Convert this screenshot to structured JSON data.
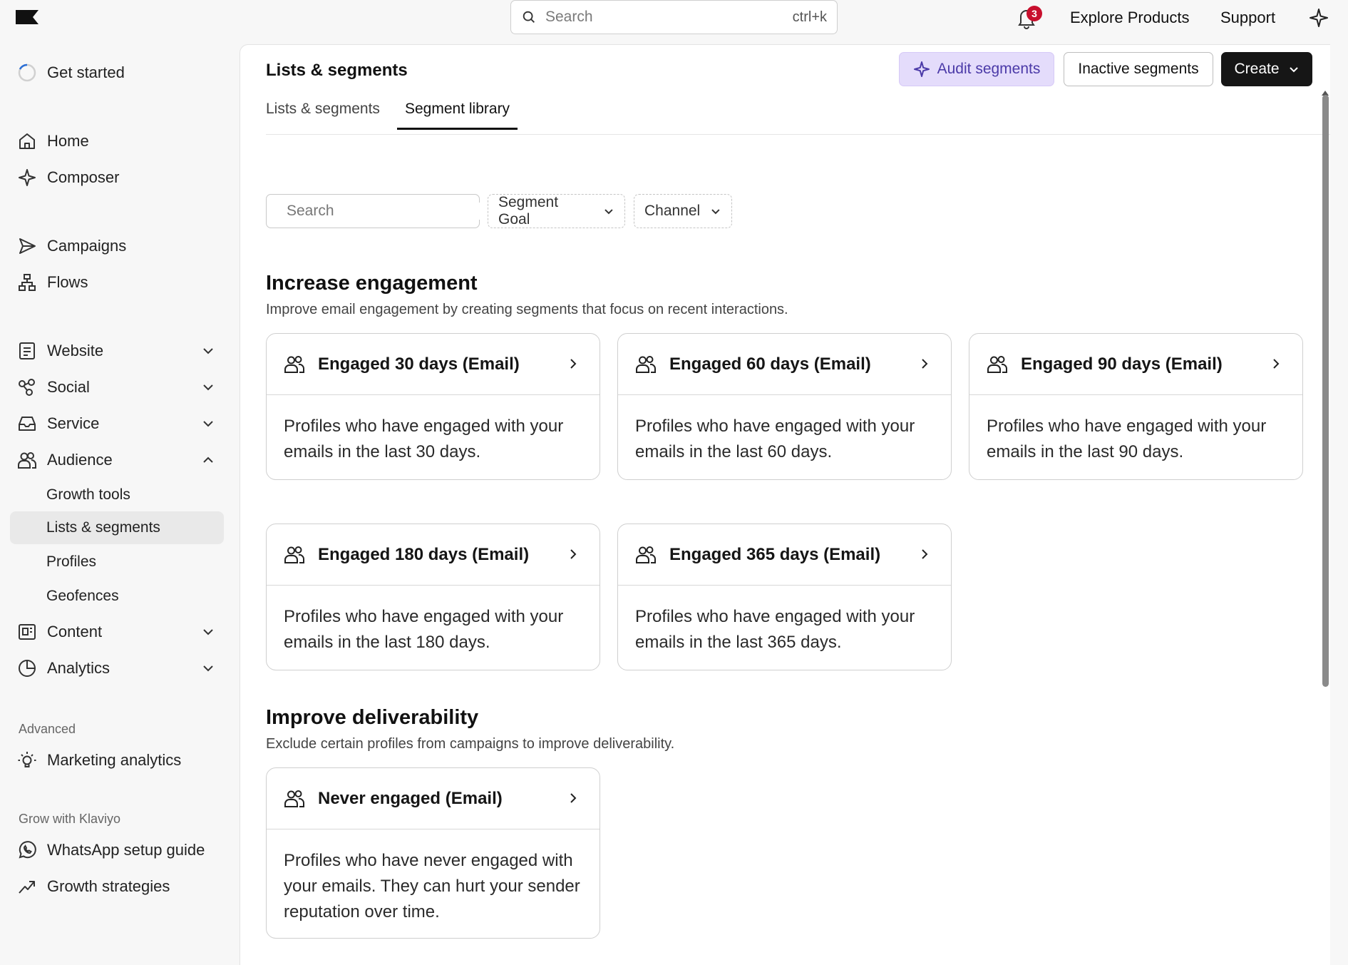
{
  "topbar": {
    "search_placeholder": "Search",
    "search_shortcut": "ctrl+k",
    "notification_count": "3",
    "explore_label": "Explore Products",
    "support_label": "Support"
  },
  "sidebar": {
    "get_started": "Get started",
    "items": [
      {
        "label": "Home",
        "icon": "home-icon"
      },
      {
        "label": "Composer",
        "icon": "sparkle-icon"
      },
      {
        "label": "Campaigns",
        "icon": "send-icon"
      },
      {
        "label": "Flows",
        "icon": "flow-icon"
      },
      {
        "label": "Website",
        "icon": "website-icon"
      },
      {
        "label": "Social",
        "icon": "social-icon"
      },
      {
        "label": "Service",
        "icon": "inbox-icon"
      },
      {
        "label": "Audience",
        "icon": "users-icon"
      },
      {
        "label": "Content",
        "icon": "content-icon"
      },
      {
        "label": "Analytics",
        "icon": "pie-chart-icon"
      }
    ],
    "audience_sub": [
      "Growth tools",
      "Lists & segments",
      "Profiles",
      "Geofences"
    ],
    "advanced_heading": "Advanced",
    "marketing_analytics": "Marketing analytics",
    "grow_heading": "Grow with Klaviyo",
    "whatsapp_guide": "WhatsApp setup guide",
    "growth_strategies": "Growth strategies"
  },
  "page": {
    "title": "Lists & segments",
    "audit_label": "Audit segments",
    "inactive_label": "Inactive segments",
    "create_label": "Create",
    "tabs": [
      "Lists & segments",
      "Segment library"
    ],
    "active_tab": "Segment library"
  },
  "filters": {
    "search_placeholder": "Search",
    "goal_label": "Segment Goal",
    "channel_label": "Channel"
  },
  "sections": [
    {
      "title": "Increase engagement",
      "description": "Improve email engagement by creating segments that focus on recent interactions.",
      "cards": [
        {
          "title": "Engaged 30 days (Email)",
          "body": "Profiles who have engaged with your emails in the last 30 days."
        },
        {
          "title": "Engaged 60 days (Email)",
          "body": "Profiles who have engaged with your emails in the last 60 days."
        },
        {
          "title": "Engaged 90 days (Email)",
          "body": "Profiles who have engaged with your emails in the last 90 days."
        },
        {
          "title": "Engaged 180 days (Email)",
          "body": "Profiles who have engaged with your emails in the last 180 days."
        },
        {
          "title": "Engaged 365 days (Email)",
          "body": "Profiles who have engaged with your emails in the last 365 days."
        }
      ]
    },
    {
      "title": "Improve deliverability",
      "description": "Exclude certain profiles from campaigns to improve deliverability.",
      "cards": [
        {
          "title": "Never engaged (Email)",
          "body": "Profiles who have never engaged with your emails. They can hurt your sender reputation over time."
        }
      ]
    }
  ],
  "colors": {
    "accent_purple": "#e4dcfb",
    "badge_red": "#c8102e",
    "create_bg": "#161616"
  }
}
